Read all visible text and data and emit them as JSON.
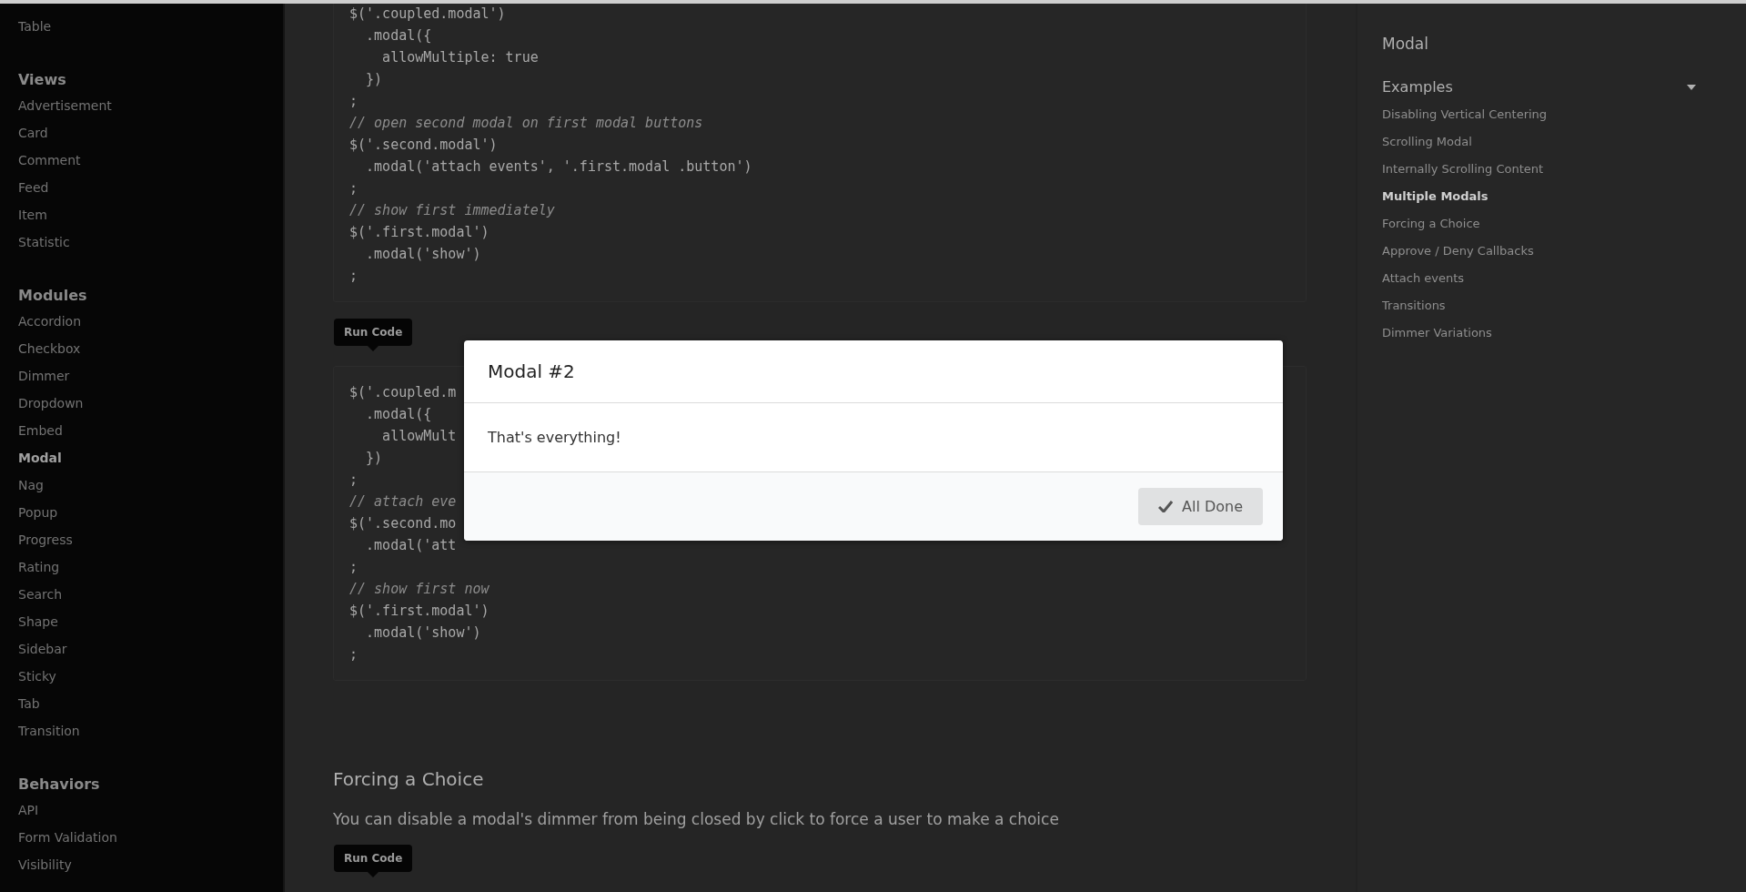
{
  "left_nav": {
    "sections": [
      {
        "items": [
          {
            "label": "Table",
            "selected": false
          }
        ]
      },
      {
        "title": "Views",
        "items": [
          {
            "label": "Advertisement",
            "selected": false
          },
          {
            "label": "Card",
            "selected": false
          },
          {
            "label": "Comment",
            "selected": false
          },
          {
            "label": "Feed",
            "selected": false
          },
          {
            "label": "Item",
            "selected": false
          },
          {
            "label": "Statistic",
            "selected": false
          }
        ]
      },
      {
        "title": "Modules",
        "items": [
          {
            "label": "Accordion",
            "selected": false
          },
          {
            "label": "Checkbox",
            "selected": false
          },
          {
            "label": "Dimmer",
            "selected": false
          },
          {
            "label": "Dropdown",
            "selected": false
          },
          {
            "label": "Embed",
            "selected": false
          },
          {
            "label": "Modal",
            "selected": true
          },
          {
            "label": "Nag",
            "selected": false
          },
          {
            "label": "Popup",
            "selected": false
          },
          {
            "label": "Progress",
            "selected": false
          },
          {
            "label": "Rating",
            "selected": false
          },
          {
            "label": "Search",
            "selected": false
          },
          {
            "label": "Shape",
            "selected": false
          },
          {
            "label": "Sidebar",
            "selected": false
          },
          {
            "label": "Sticky",
            "selected": false
          },
          {
            "label": "Tab",
            "selected": false
          },
          {
            "label": "Transition",
            "selected": false
          }
        ]
      },
      {
        "title": "Behaviors",
        "items": [
          {
            "label": "API",
            "selected": false
          },
          {
            "label": "Form Validation",
            "selected": false
          },
          {
            "label": "Visibility",
            "selected": false
          }
        ]
      }
    ]
  },
  "main": [
    {
      "kind": "code",
      "lines": [
        {
          "kind": "code",
          "text": "$('.coupled.modal')"
        },
        {
          "kind": "code",
          "text": "  .modal({"
        },
        {
          "kind": "code",
          "text": "    allowMultiple: true"
        },
        {
          "kind": "code",
          "text": "  })"
        },
        {
          "kind": "code",
          "text": ";"
        },
        {
          "kind": "comment",
          "text": "// open second modal on first modal buttons"
        },
        {
          "kind": "code",
          "text": "$('.second.modal')"
        },
        {
          "kind": "code",
          "text": "  .modal('attach events', '.first.modal .button')"
        },
        {
          "kind": "code",
          "text": ";"
        },
        {
          "kind": "comment",
          "text": "// show first immediately"
        },
        {
          "kind": "code",
          "text": "$('.first.modal')"
        },
        {
          "kind": "code",
          "text": "  .modal('show')"
        },
        {
          "kind": "code",
          "text": ";"
        }
      ]
    },
    {
      "kind": "run",
      "label": "Run Code"
    },
    {
      "kind": "code",
      "lines": [
        {
          "kind": "code",
          "text": "$('.coupled.m"
        },
        {
          "kind": "code",
          "text": "  .modal({"
        },
        {
          "kind": "code",
          "text": "    allowMult"
        },
        {
          "kind": "code",
          "text": "  })"
        },
        {
          "kind": "code",
          "text": ";"
        },
        {
          "kind": "comment",
          "text": "// attach eve"
        },
        {
          "kind": "code",
          "text": "$('.second.mo"
        },
        {
          "kind": "code",
          "text": "  .modal('att"
        },
        {
          "kind": "code",
          "text": ";"
        },
        {
          "kind": "comment",
          "text": "// show first now"
        },
        {
          "kind": "code",
          "text": "$('.first.modal')"
        },
        {
          "kind": "code",
          "text": "  .modal('show')"
        },
        {
          "kind": "code",
          "text": ";"
        }
      ]
    },
    {
      "kind": "heading",
      "text": "Forcing a Choice"
    },
    {
      "kind": "paragraph",
      "text": "You can disable a modal's dimmer from being closed by click to force a user to make a choice"
    },
    {
      "kind": "run",
      "label": "Run Code"
    }
  ],
  "modal": {
    "title": "Modal #2",
    "content": "That's everything!",
    "actions": [
      {
        "label": "All Done"
      }
    ]
  },
  "page_nav": {
    "title": "Modal",
    "section": {
      "title": "Examples",
      "expanded": true,
      "items": [
        {
          "label": "Disabling Vertical Centering",
          "selected": false
        },
        {
          "label": "Scrolling Modal",
          "selected": false
        },
        {
          "label": "Internally Scrolling Content",
          "selected": false
        },
        {
          "label": "Multiple Modals",
          "selected": true
        },
        {
          "label": "Forcing a Choice",
          "selected": false
        },
        {
          "label": "Approve / Deny Callbacks",
          "selected": false
        },
        {
          "label": "Attach events",
          "selected": false
        },
        {
          "label": "Transitions",
          "selected": false
        },
        {
          "label": "Dimmer Variations",
          "selected": false
        }
      ]
    }
  }
}
